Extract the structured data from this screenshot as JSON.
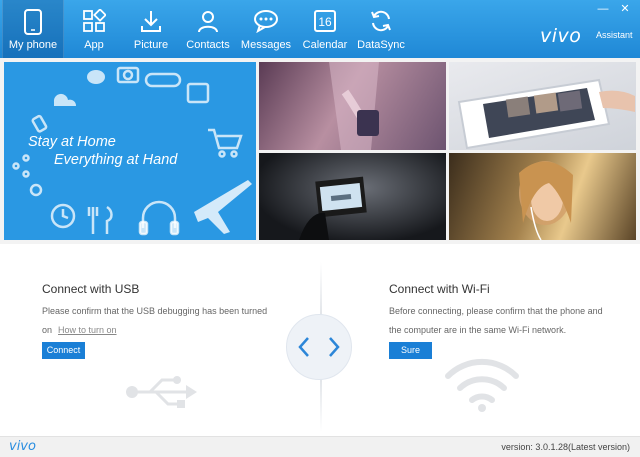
{
  "nav": [
    {
      "label": "My phone",
      "icon": "phone-icon"
    },
    {
      "label": "App",
      "icon": "app-grid-icon"
    },
    {
      "label": "Picture",
      "icon": "picture-download-icon"
    },
    {
      "label": "Contacts",
      "icon": "contacts-icon"
    },
    {
      "label": "Messages",
      "icon": "messages-icon"
    },
    {
      "label": "Calendar",
      "icon": "calendar-icon",
      "icon_text": "16"
    },
    {
      "label": "DataSync",
      "icon": "sync-icon"
    }
  ],
  "active_nav": "My phone",
  "brand": {
    "logo": "vivo",
    "sub": "Assistant"
  },
  "window_controls": {
    "minimize": "—",
    "close": "✕"
  },
  "hero": {
    "line1": "Stay at Home",
    "line2": "Everything at Hand"
  },
  "usb": {
    "title": "Connect with USB",
    "desc": "Please confirm that the USB debugging has been turned on",
    "link": "How to turn on",
    "button": "Connect"
  },
  "wifi": {
    "title": "Connect with Wi-Fi",
    "desc": "Before connecting, please confirm that the phone and the computer are in the same Wi-Fi network.",
    "button": "Sure"
  },
  "footer": {
    "logo": "vivo",
    "version": "version: 3.0.1.28(Latest version)"
  },
  "colors": {
    "toolbar": "#2a95e2",
    "accent": "#1a7fd6",
    "hero": "#2a98e3"
  }
}
